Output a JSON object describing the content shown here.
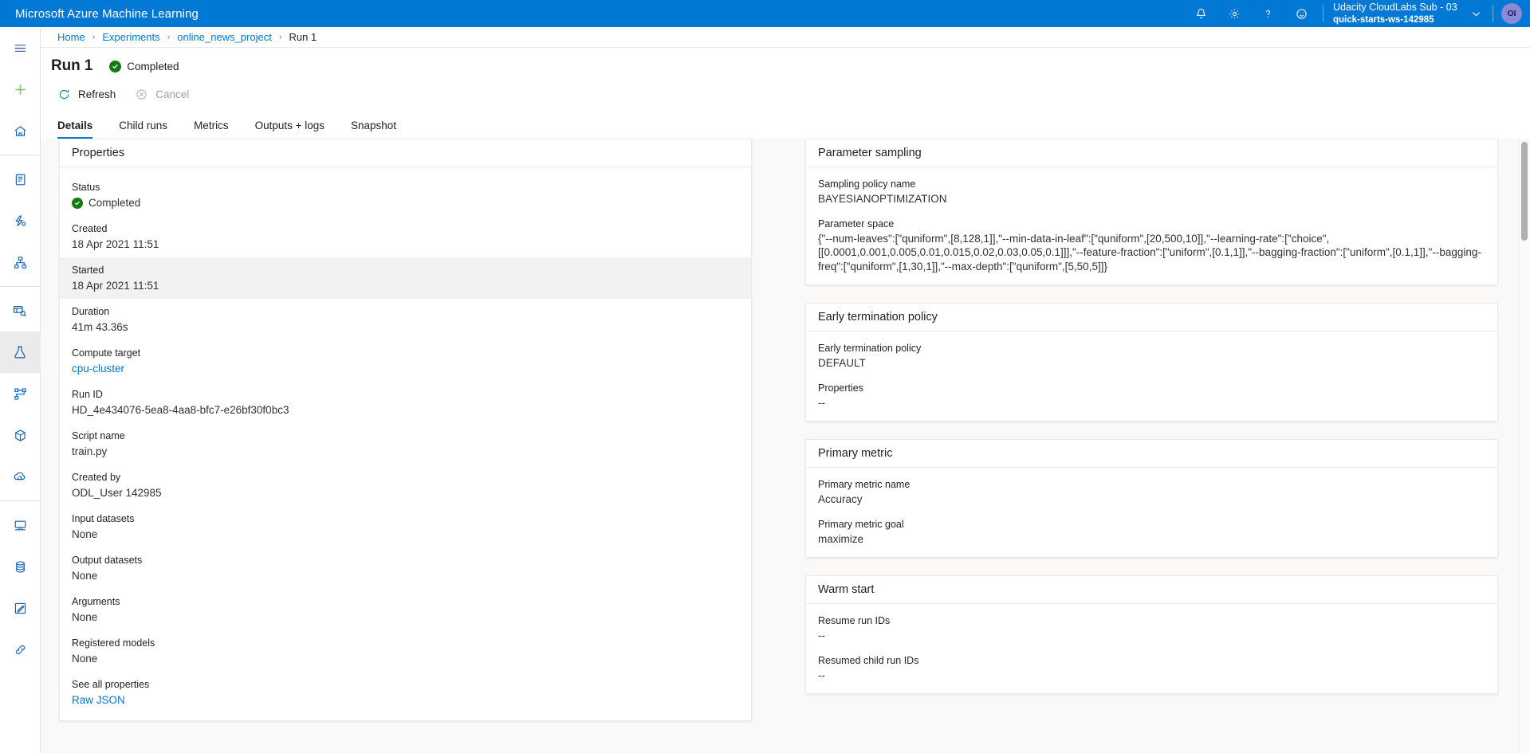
{
  "topbar": {
    "brand": "Microsoft Azure Machine Learning",
    "icons": [
      {
        "name": "notification-bell-icon",
        "label": "Notifications"
      },
      {
        "name": "gear-icon",
        "label": "Settings"
      },
      {
        "name": "help-question-icon",
        "label": "Help"
      },
      {
        "name": "feedback-smiley-icon",
        "label": "Feedback"
      }
    ],
    "account": {
      "subscription": "Udacity CloudLabs Sub - 03",
      "workspace": "quick-starts-ws-142985",
      "avatar_initials": "OI"
    },
    "brand_color": "#0078D4"
  },
  "rail": {
    "items": [
      {
        "name": "hamburger-menu-icon",
        "label": "Menu",
        "active": false
      },
      {
        "name": "new-plus-icon",
        "label": "New",
        "active": false
      },
      {
        "name": "home-icon",
        "label": "Home",
        "active": false
      },
      {
        "name": "notebooks-icon",
        "label": "Notebooks",
        "active": false
      },
      {
        "name": "automated-ml-icon",
        "label": "Automated ML",
        "active": false
      },
      {
        "name": "designer-icon",
        "label": "Designer",
        "active": false
      },
      {
        "name": "datasets-icon",
        "label": "Datasets",
        "active": false
      },
      {
        "name": "experiments-flask-icon",
        "label": "Experiments",
        "active": true
      },
      {
        "name": "pipelines-icon",
        "label": "Pipelines",
        "active": false
      },
      {
        "name": "models-cube-icon",
        "label": "Models",
        "active": false
      },
      {
        "name": "endpoints-cloud-icon",
        "label": "Endpoints",
        "active": false
      },
      {
        "name": "compute-monitor-icon",
        "label": "Compute",
        "active": false
      },
      {
        "name": "datastores-icon",
        "label": "Datastores",
        "active": false
      },
      {
        "name": "data-labeling-icon",
        "label": "Data labeling",
        "active": false
      },
      {
        "name": "linked-services-icon",
        "label": "Linked services",
        "active": false
      }
    ]
  },
  "breadcrumb": {
    "items": [
      {
        "label": "Home",
        "current": false
      },
      {
        "label": "Experiments",
        "current": false
      },
      {
        "label": "online_news_project",
        "current": false
      },
      {
        "label": "Run 1",
        "current": true
      }
    ],
    "separator": "›"
  },
  "page": {
    "title": "Run 1",
    "status": "Completed"
  },
  "commands": {
    "refresh": "Refresh",
    "cancel": "Cancel"
  },
  "tabs": [
    {
      "label": "Details",
      "active": true
    },
    {
      "label": "Child runs",
      "active": false
    },
    {
      "label": "Metrics",
      "active": false
    },
    {
      "label": "Outputs + logs",
      "active": false
    },
    {
      "label": "Snapshot",
      "active": false
    }
  ],
  "properties_card": {
    "title": "Properties",
    "rows": [
      {
        "key": "Status",
        "value": "Completed",
        "kind": "status",
        "highlight": false
      },
      {
        "key": "Created",
        "value": "18 Apr 2021 11:51",
        "kind": "text",
        "highlight": false
      },
      {
        "key": "Started",
        "value": "18 Apr 2021 11:51",
        "kind": "text",
        "highlight": true
      },
      {
        "key": "Duration",
        "value": "41m 43.36s",
        "kind": "text",
        "highlight": false
      },
      {
        "key": "Compute target",
        "value": "cpu-cluster",
        "kind": "link",
        "highlight": false
      },
      {
        "key": "Run ID",
        "value": "HD_4e434076-5ea8-4aa8-bfc7-e26bf30f0bc3",
        "kind": "text",
        "highlight": false
      },
      {
        "key": "Script name",
        "value": "train.py",
        "kind": "text",
        "highlight": false
      },
      {
        "key": "Created by",
        "value": "ODL_User 142985",
        "kind": "text",
        "highlight": false
      },
      {
        "key": "Input datasets",
        "value": "None",
        "kind": "text",
        "highlight": false
      },
      {
        "key": "Output datasets",
        "value": "None",
        "kind": "text",
        "highlight": false
      },
      {
        "key": "Arguments",
        "value": "None",
        "kind": "text",
        "highlight": false
      },
      {
        "key": "Registered models",
        "value": "None",
        "kind": "text",
        "highlight": false
      },
      {
        "key": "See all properties",
        "value": "Raw JSON",
        "kind": "link",
        "highlight": false
      }
    ]
  },
  "parameter_sampling_card": {
    "title": "Parameter sampling",
    "sampling_policy_name_label": "Sampling policy name",
    "sampling_policy_name_value": "BAYESIANOPTIMIZATION",
    "parameter_space_label": "Parameter space",
    "parameter_space_value": "{\"--num-leaves\":[\"quniform\",[8,128,1]],\"--min-data-in-leaf\":[\"quniform\",[20,500,10]],\"--learning-rate\":[\"choice\",[[0.0001,0.001,0.005,0.01,0.015,0.02,0.03,0.05,0.1]]],\"--feature-fraction\":[\"uniform\",[0.1,1]],\"--bagging-fraction\":[\"uniform\",[0.1,1]],\"--bagging-freq\":[\"quniform\",[1,30,1]],\"--max-depth\":[\"quniform\",[5,50,5]]}"
  },
  "early_termination_card": {
    "title": "Early termination policy",
    "policy_label": "Early termination policy",
    "policy_value": "DEFAULT",
    "properties_label": "Properties",
    "properties_value": "--"
  },
  "primary_metric_card": {
    "title": "Primary metric",
    "name_label": "Primary metric name",
    "name_value": "Accuracy",
    "goal_label": "Primary metric goal",
    "goal_value": "maximize"
  },
  "warm_start_card": {
    "title": "Warm start",
    "resume_label": "Resume run IDs",
    "resume_value": "--",
    "resumed_child_label": "Resumed child run IDs",
    "resumed_child_value": "--"
  },
  "colors": {
    "accent": "#0078D4",
    "success": "#107C10",
    "page_bg": "#faf9f8",
    "card_bg": "#ffffff",
    "border": "#ebe9e7",
    "highlight_row": "#f3f2f1"
  }
}
